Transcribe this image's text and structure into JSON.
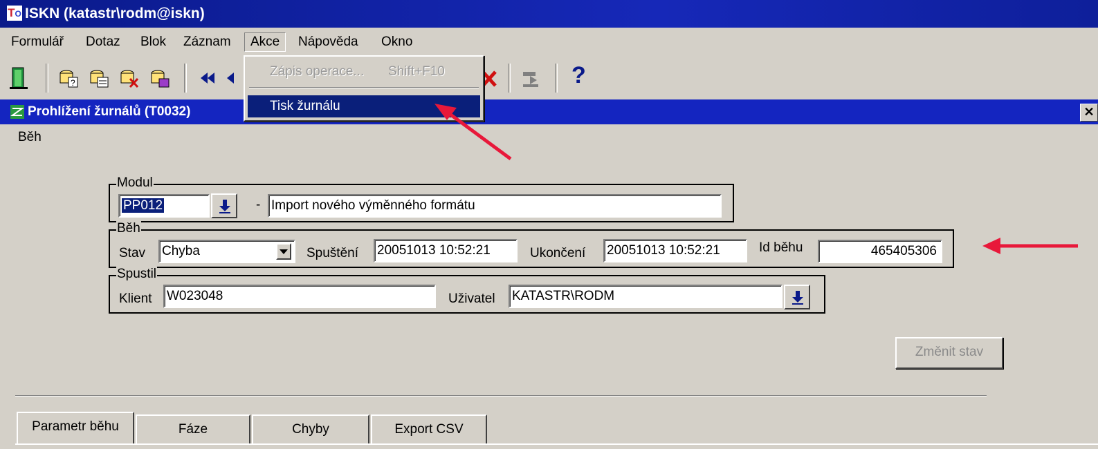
{
  "app_title": "ISKN (katastr\\rodm@iskn)",
  "app_logo": "T",
  "app_logo_sub": "O",
  "menu": [
    "Formulář",
    "Dotaz",
    "Blok",
    "Záznam",
    "Akce",
    "Nápověda",
    "Okno"
  ],
  "active_menu": "Akce",
  "dropdown": {
    "disabled_item": "Zápis operace...",
    "disabled_shortcut": "Shift+F10",
    "selected_item": "Tisk žurnálu"
  },
  "window": {
    "title": "Prohlížení žurnálů (T0032)",
    "close": "✕",
    "menu": "Běh"
  },
  "modul": {
    "label": "Modul",
    "code": "PP012",
    "dash": "-",
    "name": "Import nového výměnného formátu"
  },
  "beh": {
    "label": "Běh",
    "stav_label": "Stav",
    "stav_value": "Chyba",
    "spusteni_label": "Spuštění",
    "spusteni_value": "20051013 10:52:21",
    "ukonceni_label": "Ukončení",
    "ukonceni_value": "20051013 10:52:21",
    "id_label": "Id běhu",
    "id_value": "465405306"
  },
  "spustil": {
    "label": "Spustil",
    "klient_label": "Klient",
    "klient_value": "W023048",
    "uzivatel_label": "Uživatel",
    "uzivatel_value": "KATASTR\\RODM"
  },
  "zmenit_stav": "Změnit stav",
  "tabs": [
    "Parametr běhu",
    "Fáze",
    "Chyby",
    "Export CSV"
  ],
  "help_glyph": "?",
  "colors": {
    "desktop": "#1c2ed6",
    "title": "#1425c0",
    "selection": "#0a1f7a",
    "annotation_arrow": "#e8183a"
  }
}
